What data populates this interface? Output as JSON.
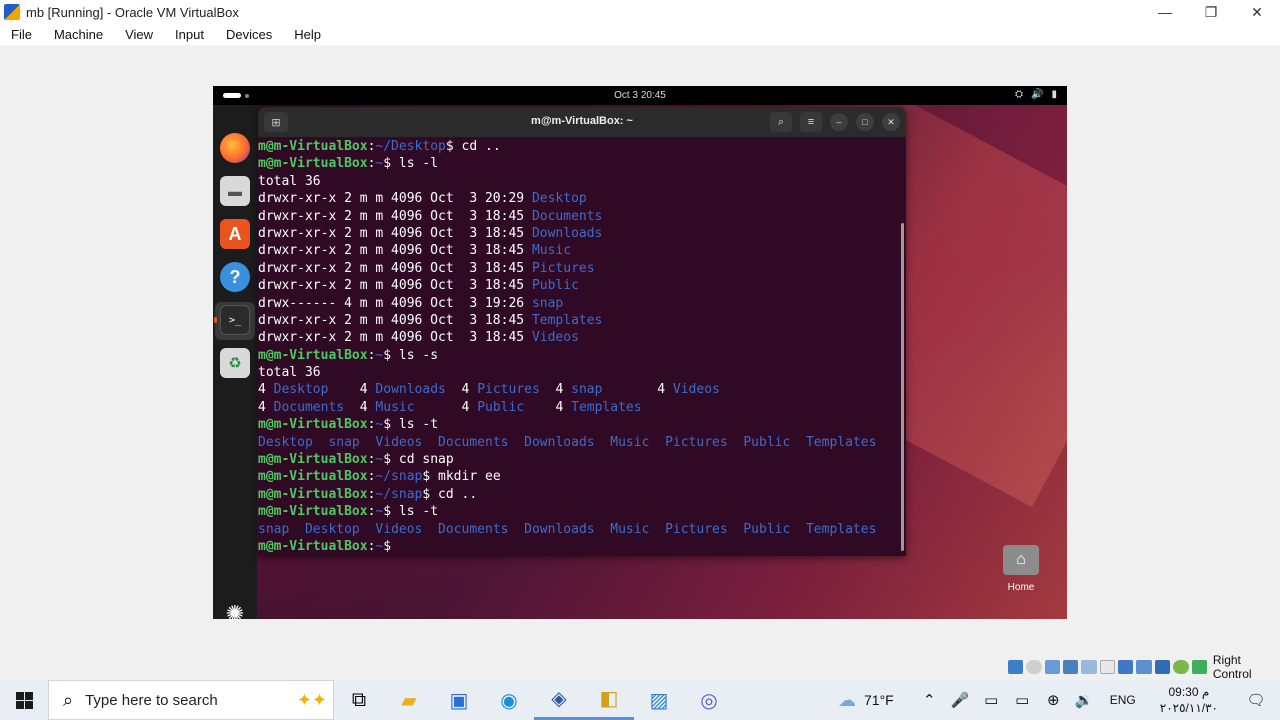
{
  "host_window": {
    "title": "mb [Running] - Oracle VM VirtualBox",
    "minimize": "—",
    "restore": "❐",
    "close": "✕"
  },
  "menu": [
    "File",
    "Machine",
    "View",
    "Input",
    "Devices",
    "Help"
  ],
  "guest": {
    "clock": "Oct 3  20:45",
    "terminal_title": "m@m-VirtualBox: ~",
    "desktop_home_label": "Home"
  },
  "terminal_lines": [
    [
      {
        "t": "m@m-VirtualBox",
        "c": "u"
      },
      {
        "t": ":",
        "c": "w"
      },
      {
        "t": "~/Desktop",
        "c": "p"
      },
      {
        "t": "$ cd ..",
        "c": "w"
      }
    ],
    [
      {
        "t": "m@m-VirtualBox",
        "c": "u"
      },
      {
        "t": ":",
        "c": "w"
      },
      {
        "t": "~",
        "c": "p"
      },
      {
        "t": "$ ls -l",
        "c": "w"
      }
    ],
    [
      {
        "t": "total 36",
        "c": "w"
      }
    ],
    [
      {
        "t": "drwxr-xr-x 2 m m 4096 Oct  3 20:29 ",
        "c": "w"
      },
      {
        "t": "Desktop",
        "c": "d"
      }
    ],
    [
      {
        "t": "drwxr-xr-x 2 m m 4096 Oct  3 18:45 ",
        "c": "w"
      },
      {
        "t": "Documents",
        "c": "d"
      }
    ],
    [
      {
        "t": "drwxr-xr-x 2 m m 4096 Oct  3 18:45 ",
        "c": "w"
      },
      {
        "t": "Downloads",
        "c": "d"
      }
    ],
    [
      {
        "t": "drwxr-xr-x 2 m m 4096 Oct  3 18:45 ",
        "c": "w"
      },
      {
        "t": "Music",
        "c": "d"
      }
    ],
    [
      {
        "t": "drwxr-xr-x 2 m m 4096 Oct  3 18:45 ",
        "c": "w"
      },
      {
        "t": "Pictures",
        "c": "d"
      }
    ],
    [
      {
        "t": "drwxr-xr-x 2 m m 4096 Oct  3 18:45 ",
        "c": "w"
      },
      {
        "t": "Public",
        "c": "d"
      }
    ],
    [
      {
        "t": "drwx------ 4 m m 4096 Oct  3 19:26 ",
        "c": "w"
      },
      {
        "t": "snap",
        "c": "d"
      }
    ],
    [
      {
        "t": "drwxr-xr-x 2 m m 4096 Oct  3 18:45 ",
        "c": "w"
      },
      {
        "t": "Templates",
        "c": "d"
      }
    ],
    [
      {
        "t": "drwxr-xr-x 2 m m 4096 Oct  3 18:45 ",
        "c": "w"
      },
      {
        "t": "Videos",
        "c": "d"
      }
    ],
    [
      {
        "t": "m@m-VirtualBox",
        "c": "u"
      },
      {
        "t": ":",
        "c": "w"
      },
      {
        "t": "~",
        "c": "p"
      },
      {
        "t": "$ ls -s",
        "c": "w"
      }
    ],
    [
      {
        "t": "total 36",
        "c": "w"
      }
    ],
    [
      {
        "t": "4 ",
        "c": "w"
      },
      {
        "t": "Desktop",
        "c": "d"
      },
      {
        "t": "    4 ",
        "c": "w"
      },
      {
        "t": "Downloads",
        "c": "d"
      },
      {
        "t": "  4 ",
        "c": "w"
      },
      {
        "t": "Pictures",
        "c": "d"
      },
      {
        "t": "  4 ",
        "c": "w"
      },
      {
        "t": "snap",
        "c": "d"
      },
      {
        "t": "       4 ",
        "c": "w"
      },
      {
        "t": "Videos",
        "c": "d"
      }
    ],
    [
      {
        "t": "4 ",
        "c": "w"
      },
      {
        "t": "Documents",
        "c": "d"
      },
      {
        "t": "  4 ",
        "c": "w"
      },
      {
        "t": "Music",
        "c": "d"
      },
      {
        "t": "      4 ",
        "c": "w"
      },
      {
        "t": "Public",
        "c": "d"
      },
      {
        "t": "    4 ",
        "c": "w"
      },
      {
        "t": "Templates",
        "c": "d"
      }
    ],
    [
      {
        "t": "m@m-VirtualBox",
        "c": "u"
      },
      {
        "t": ":",
        "c": "w"
      },
      {
        "t": "~",
        "c": "p"
      },
      {
        "t": "$ ls -t",
        "c": "w"
      }
    ],
    [
      {
        "t": "Desktop",
        "c": "d"
      },
      {
        "t": "  ",
        "c": "w"
      },
      {
        "t": "snap",
        "c": "d"
      },
      {
        "t": "  ",
        "c": "w"
      },
      {
        "t": "Videos",
        "c": "d"
      },
      {
        "t": "  ",
        "c": "w"
      },
      {
        "t": "Documents",
        "c": "d"
      },
      {
        "t": "  ",
        "c": "w"
      },
      {
        "t": "Downloads",
        "c": "d"
      },
      {
        "t": "  ",
        "c": "w"
      },
      {
        "t": "Music",
        "c": "d"
      },
      {
        "t": "  ",
        "c": "w"
      },
      {
        "t": "Pictures",
        "c": "d"
      },
      {
        "t": "  ",
        "c": "w"
      },
      {
        "t": "Public",
        "c": "d"
      },
      {
        "t": "  ",
        "c": "w"
      },
      {
        "t": "Templates",
        "c": "d"
      }
    ],
    [
      {
        "t": "m@m-VirtualBox",
        "c": "u"
      },
      {
        "t": ":",
        "c": "w"
      },
      {
        "t": "~",
        "c": "p"
      },
      {
        "t": "$ cd snap",
        "c": "w"
      }
    ],
    [
      {
        "t": "m@m-VirtualBox",
        "c": "u"
      },
      {
        "t": ":",
        "c": "w"
      },
      {
        "t": "~/snap",
        "c": "p"
      },
      {
        "t": "$ mkdir ee",
        "c": "w"
      }
    ],
    [
      {
        "t": "m@m-VirtualBox",
        "c": "u"
      },
      {
        "t": ":",
        "c": "w"
      },
      {
        "t": "~/snap",
        "c": "p"
      },
      {
        "t": "$ cd ..",
        "c": "w"
      }
    ],
    [
      {
        "t": "m@m-VirtualBox",
        "c": "u"
      },
      {
        "t": ":",
        "c": "w"
      },
      {
        "t": "~",
        "c": "p"
      },
      {
        "t": "$ ls -t",
        "c": "w"
      }
    ],
    [
      {
        "t": "snap",
        "c": "d"
      },
      {
        "t": "  ",
        "c": "w"
      },
      {
        "t": "Desktop",
        "c": "d"
      },
      {
        "t": "  ",
        "c": "w"
      },
      {
        "t": "Videos",
        "c": "d"
      },
      {
        "t": "  ",
        "c": "w"
      },
      {
        "t": "Documents",
        "c": "d"
      },
      {
        "t": "  ",
        "c": "w"
      },
      {
        "t": "Downloads",
        "c": "d"
      },
      {
        "t": "  ",
        "c": "w"
      },
      {
        "t": "Music",
        "c": "d"
      },
      {
        "t": "  ",
        "c": "w"
      },
      {
        "t": "Pictures",
        "c": "d"
      },
      {
        "t": "  ",
        "c": "w"
      },
      {
        "t": "Public",
        "c": "d"
      },
      {
        "t": "  ",
        "c": "w"
      },
      {
        "t": "Templates",
        "c": "d"
      }
    ],
    [
      {
        "t": "m@m-VirtualBox",
        "c": "u"
      },
      {
        "t": ":",
        "c": "w"
      },
      {
        "t": "~",
        "c": "p"
      },
      {
        "t": "$ ",
        "c": "w"
      }
    ]
  ],
  "vbox_status": {
    "host_key": "Right Control"
  },
  "taskbar": {
    "search_placeholder": "Type here to search",
    "weather": "71°F",
    "language": "ENG",
    "time": "09:30 م",
    "date": "٢٠٢٥/١١/٣٠"
  },
  "colors": {
    "terminal_bg": "#300a24",
    "prompt_user": "#4ec860",
    "prompt_path": "#3d6bcc",
    "dir": "#3d6bcc"
  }
}
